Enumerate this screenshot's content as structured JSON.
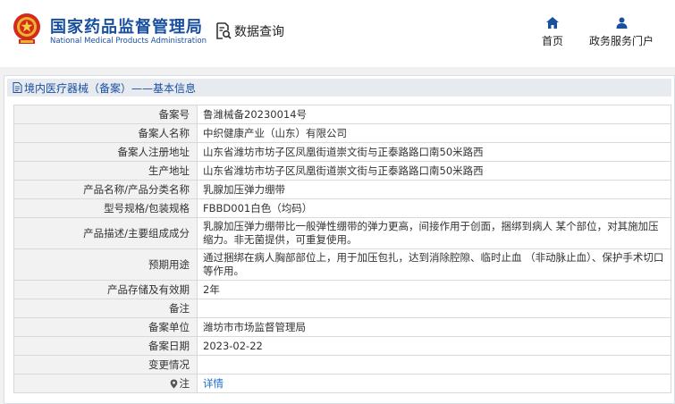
{
  "header": {
    "brand_cn": "国家药品监督管理局",
    "brand_en": "National Medical Products Administration",
    "data_query": "数据查询",
    "nav": {
      "home": "首页",
      "gov_portal": "政务服务门户"
    },
    "brand_color": "#1a4fa0"
  },
  "breadcrumb": {
    "text": "境内医疗器械（备案）——基本信息"
  },
  "rows": [
    {
      "label": "备案号",
      "value": "鲁潍械备20230014号"
    },
    {
      "label": "备案人名称",
      "value": "中织健康产业（山东）有限公司"
    },
    {
      "label": "备案人注册地址",
      "value": "山东省潍坊市坊子区凤凰街道崇文街与正泰路路口南50米路西"
    },
    {
      "label": "生产地址",
      "value": "山东省潍坊市坊子区凤凰街道崇文街与正泰路路口南50米路西"
    },
    {
      "label": "产品名称/产品分类名称",
      "value": "乳腺加压弹力绷带"
    },
    {
      "label": "型号规格/包装规格",
      "value": "FBBD001白色（均码）"
    },
    {
      "label": "产品描述/主要组成成分",
      "value": "乳腺加压弹力绷带比一般弹性绷带的弹力更高，间接作用于创面，捆绑到病人 某个部位，对其施加压缩力。非无菌提供，可重复使用。"
    },
    {
      "label": "预期用途",
      "value": "通过捆绑在病人胸部部位上，用于加压包扎，达到消除腔隙、临时止血 （非动脉止血）、保护手术切口等作用。"
    },
    {
      "label": "产品存储及有效期",
      "value": "2年"
    },
    {
      "label": "备注",
      "value": ""
    },
    {
      "label": "备案单位",
      "value": "潍坊市市场监督管理局"
    },
    {
      "label": "备案日期",
      "value": "2023-02-22"
    },
    {
      "label": "变更情况",
      "value": ""
    }
  ],
  "note_row": {
    "label": "注",
    "link": "详情"
  }
}
